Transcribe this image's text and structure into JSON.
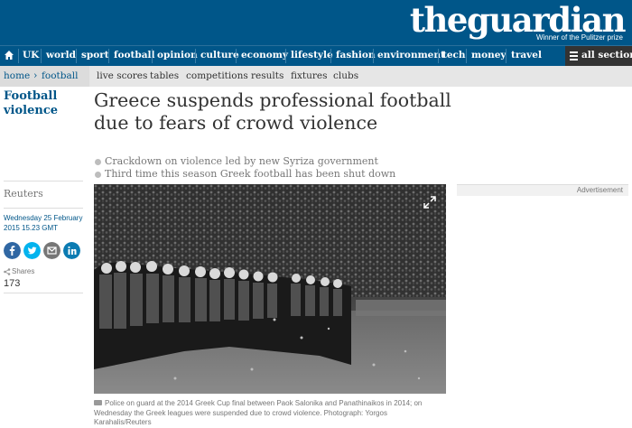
{
  "brand": {
    "logo_the": "the",
    "logo_guardian": "guardian",
    "tagline": "Winner of the Pulitzer prize",
    "color": "#005689"
  },
  "nav": {
    "items": [
      "UK",
      "world",
      "sport",
      "football",
      "opinion",
      "culture",
      "economy",
      "lifestyle",
      "fashion",
      "environment",
      "tech",
      "money",
      "travel"
    ],
    "all_sections": "all sections",
    "home_icon": "home-icon"
  },
  "subnav": {
    "home": "home",
    "section": "football",
    "links": [
      "live scores",
      "tables",
      "competitions",
      "results",
      "fixtures",
      "clubs"
    ]
  },
  "article": {
    "section_label": "Football violence",
    "headline": "Greece suspends professional football due to fears of crowd violence",
    "standfirst": [
      "Crackdown on violence led by new Syriza government",
      "Third time this season Greek football has been shut down"
    ],
    "byline": "Reuters",
    "date": "Wednesday 25 February 2015 15.23 GMT",
    "shares_label": "Shares",
    "shares_count": "173",
    "share_buttons": [
      "facebook-icon",
      "twitter-icon",
      "email-icon",
      "linkedin-icon"
    ],
    "caption": "Police on guard at the 2014 Greek Cup final between Paok Salonika and Panathinaikos in 2014; on Wednesday the Greek leagues were suspended due to crowd violence. Photograph: Yorgos Karahalis/Reuters"
  },
  "advert": {
    "label": "Advertisement"
  }
}
